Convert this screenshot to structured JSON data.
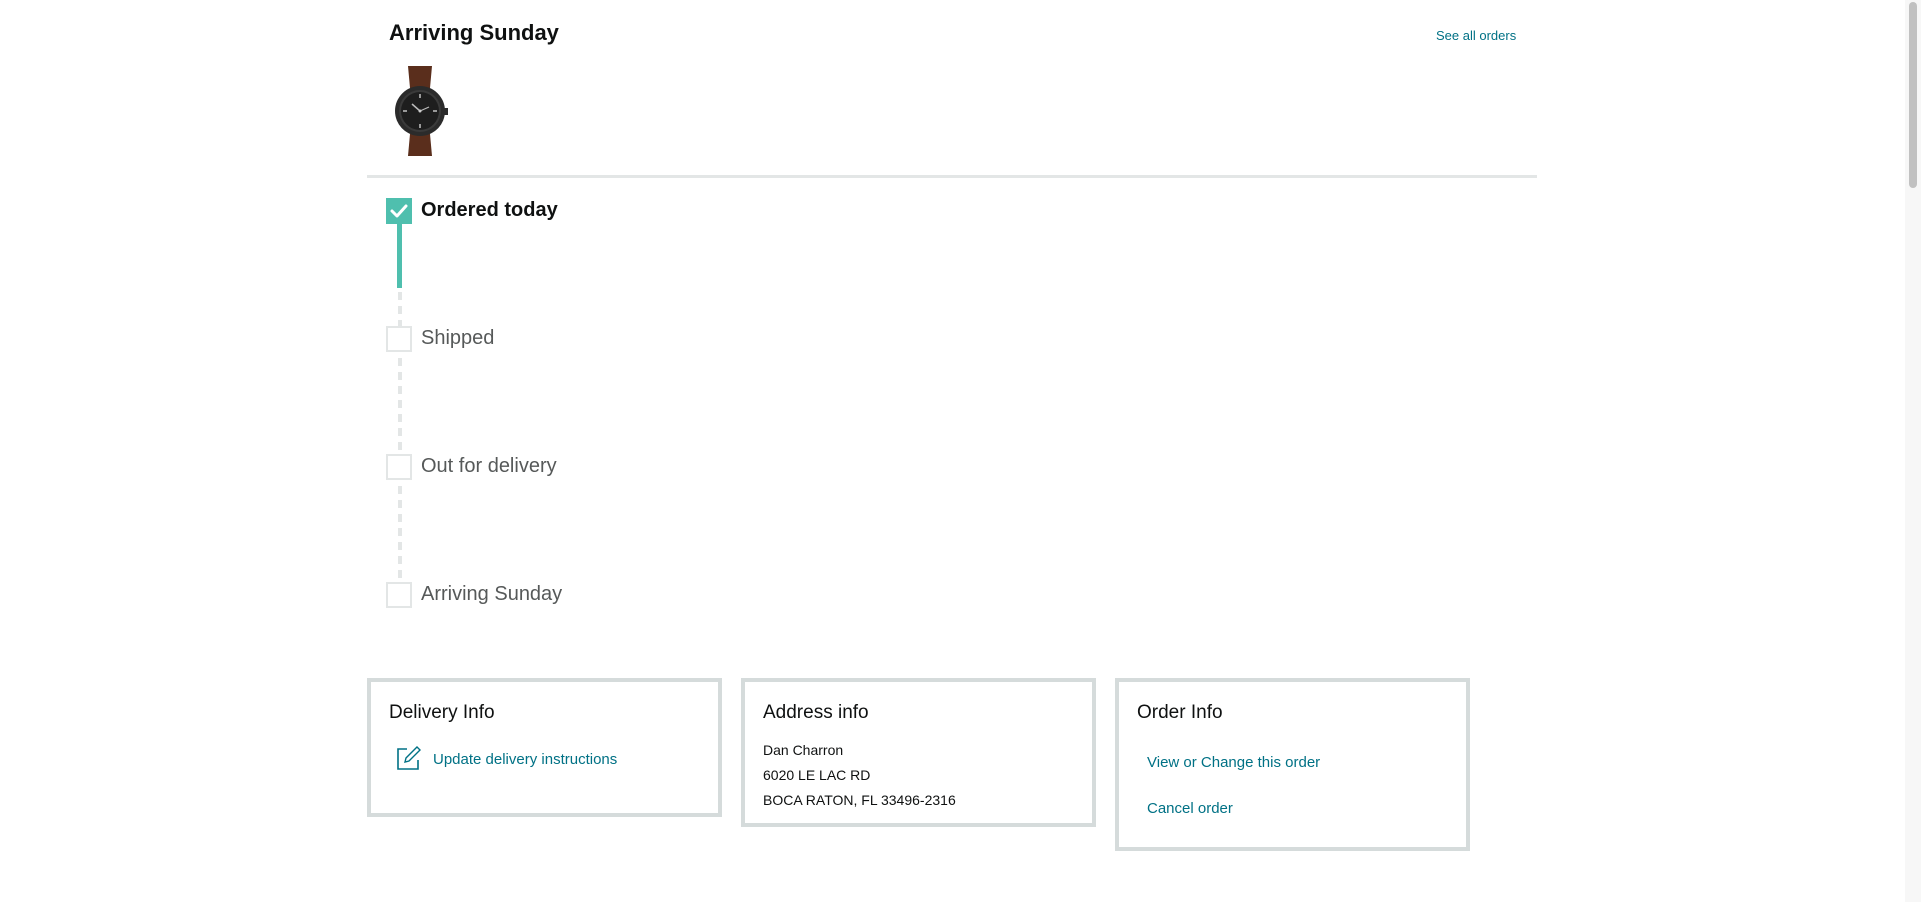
{
  "header": {
    "title": "Arriving Sunday",
    "see_all_orders": "See all orders"
  },
  "product": {
    "image_icon": "wristwatch-image"
  },
  "tracker": {
    "steps": [
      {
        "label": "Ordered today",
        "status": "complete"
      },
      {
        "label": "Shipped",
        "status": "pending"
      },
      {
        "label": "Out for delivery",
        "status": "pending"
      },
      {
        "label": "Arriving Sunday",
        "status": "pending"
      }
    ],
    "accent_color": "#4fbfae"
  },
  "delivery_info": {
    "title": "Delivery Info",
    "update_link": "Update delivery instructions"
  },
  "address_info": {
    "title": "Address info",
    "name": "Dan Charron",
    "street": "6020 LE LAC RD",
    "city_line": "BOCA RATON, FL 33496-2316"
  },
  "order_info": {
    "title": "Order Info",
    "view_change": "View or Change this order",
    "cancel": "Cancel order"
  },
  "colors": {
    "link": "#007185",
    "border": "#d5dbdb"
  }
}
